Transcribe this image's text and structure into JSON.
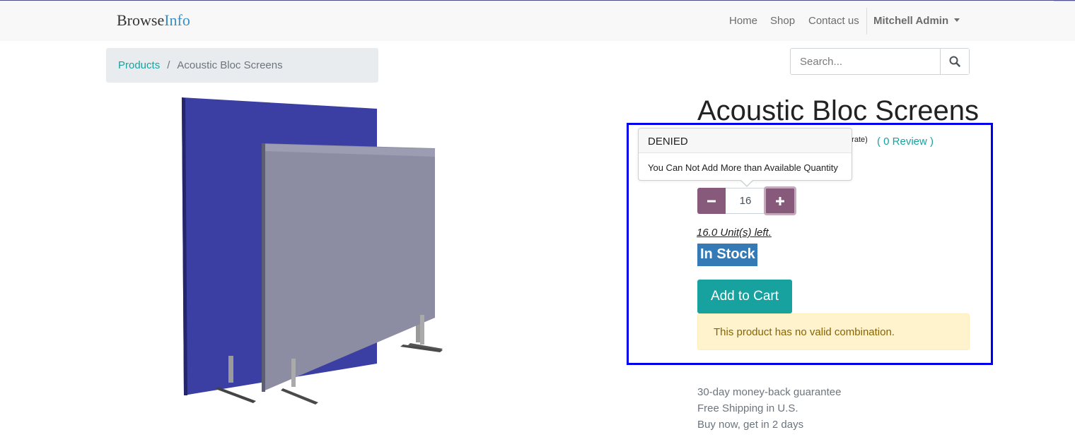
{
  "navbar": {
    "brand_main": "Browse",
    "brand_accent": "Info",
    "links": [
      "Home",
      "Shop",
      "Contact us"
    ],
    "user": "Mitchell Admin"
  },
  "breadcrumb": {
    "parent": "Products",
    "separator": "/",
    "current": "Acoustic Bloc Screens"
  },
  "search": {
    "placeholder": "Search..."
  },
  "product": {
    "title": "Acoustic Bloc Screens",
    "rating_text": "o rate)",
    "reviews": "( 0 Review )",
    "quantity": "16",
    "units_left": "16.0 Unit(s) left.",
    "stock_status": "In Stock",
    "add_to_cart": "Add to Cart",
    "alert": "This product has no valid combination."
  },
  "popover": {
    "title": "DENIED",
    "message": "You Can Not Add More than Available Quantity"
  },
  "guarantees": [
    "30-day money-back guarantee",
    "Free Shipping in U.S.",
    "Buy now, get in 2 days"
  ],
  "colors": {
    "accent_teal": "#17a2a0",
    "quantity_button": "#875a7b",
    "stock_badge": "#337ab7",
    "highlight_border": "#0000ee",
    "alert_bg": "#fff3cd"
  }
}
